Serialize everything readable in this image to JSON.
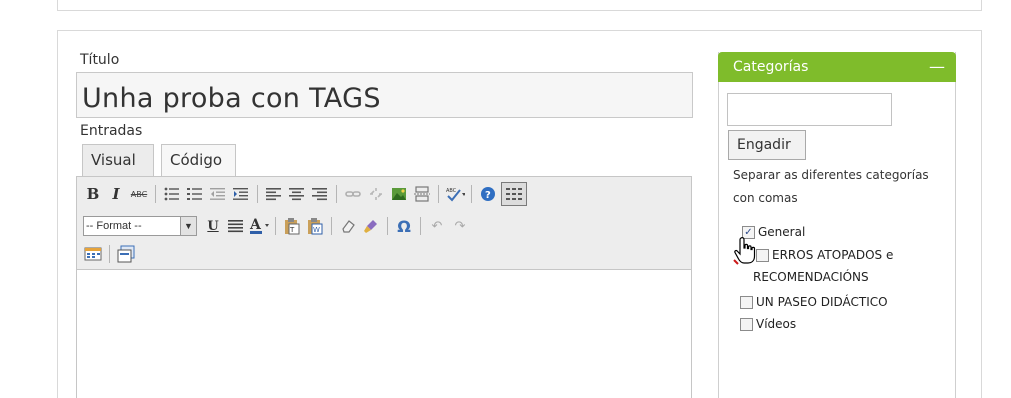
{
  "form": {
    "title_label": "Título",
    "title_value": "Unha proba con TAGS",
    "entries_label": "Entradas",
    "tabs": [
      {
        "label": "Visual"
      },
      {
        "label": "Código"
      }
    ]
  },
  "toolbar": {
    "bold": "B",
    "italic": "I",
    "strike": "ABC",
    "underline": "U",
    "format_select": "-- Format --",
    "omega": "Ω"
  },
  "categories": {
    "header": "Categorías",
    "collapse": "—",
    "new_category_value": "",
    "add_button": "Engadir",
    "help": "Separar as diferentes categorías con comas",
    "items": [
      {
        "label": "General",
        "checked": true
      },
      {
        "label": "ERROS ATOPADOS e",
        "checked": false
      },
      {
        "label": "RECOMENDACIÓNS"
      },
      {
        "label": "UN PASEO DIDÁCTICO",
        "checked": false
      },
      {
        "label": "Vídeos",
        "checked": false
      }
    ]
  },
  "colors": {
    "panel_header": "#7fbc2b",
    "toolbar_bg": "#ededed",
    "border": "#c6c6c6"
  }
}
